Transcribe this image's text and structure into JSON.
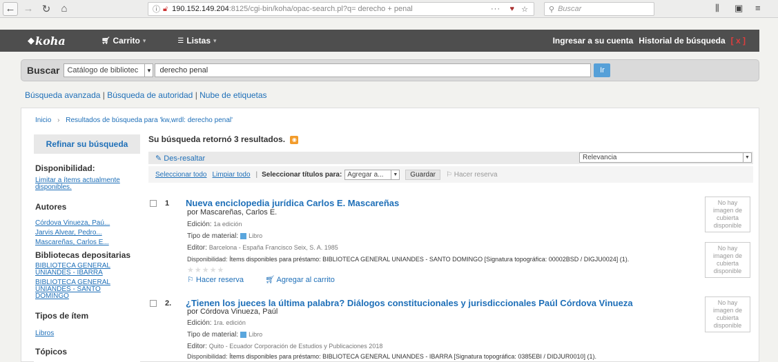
{
  "browser": {
    "url_host": "190.152.149.204",
    "url_path": ":8125/cgi-bin/koha/opac-search.pl?q= derecho + penal",
    "search_placeholder": "Buscar",
    "more": "···"
  },
  "navbar": {
    "logo": "koha",
    "cart": "Carrito",
    "lists": "Listas",
    "login": "Ingresar a su cuenta",
    "history": "Historial de búsqueda",
    "history_clear": "[ x ]"
  },
  "search": {
    "label": "Buscar",
    "scope": "Catálogo de bibliotec",
    "query": "derecho penal",
    "go": "Ir"
  },
  "links": {
    "advanced": "Búsqueda avanzada",
    "authority": "Búsqueda de autoridad",
    "tags": "Nube de etiquetas"
  },
  "breadcrumb": {
    "home": "Inicio",
    "current": "Resultados de búsqueda para 'kw,wrdl: derecho penal'"
  },
  "sidebar": {
    "refine": "Refinar su búsqueda",
    "availability_h": "Disponibilidad:",
    "availability_link": "Limitar a ítems actualmente disponibles.",
    "authors_h": "Autores",
    "authors": [
      "Córdova Vinueza, Paú...",
      "Jarvis Alvear, Pedro...",
      "Mascareñas, Carlos E..."
    ],
    "libraries_h": "Bibliotecas depositarias",
    "libraries": [
      "BIBLIOTECA GENERAL UNIANDES - IBARRA",
      "BIBLIOTECA GENERAL UNIANDES - SANTO DOMINGO"
    ],
    "itemtypes_h": "Tipos de ítem",
    "itemtypes": [
      "Libros"
    ],
    "topics_h": "Tópicos"
  },
  "results": {
    "count": "Su búsqueda retornó 3 resultados.",
    "unhighlight": "Des-resaltar",
    "sort": "Relevancia",
    "select_all": "Seleccionar todo",
    "clear_all": "Limpiar todo",
    "select_titles": "Seleccionar títulos para:",
    "add_to": "Agregar a...",
    "save": "Guardar",
    "place_hold": "Hacer reserva",
    "no_cover": "No hay imagen de cubierta disponible",
    "records": [
      {
        "num": "1",
        "title": "Nueva enciclopedia jurídica Carlos E. Mascareñas",
        "by": "por Mascareñas, Carlos E.",
        "edition_k": "Edición:",
        "edition_v": "1a edición",
        "material_k": "Tipo de material:",
        "material_v": "Libro",
        "publisher_k": "Editor:",
        "publisher_v": "Barcelona - España Francisco Seix, S. A. 1985",
        "avail_k": "Disponibilidad:",
        "avail_v": "Ítems disponibles para préstamo: BIBLIOTECA GENERAL UNIANDES - SANTO DOMINGO [Signatura topográfica: 00002BSD / DIGJU0024] (1).",
        "stars": "★★★★★",
        "hold": "Hacer reserva",
        "cart": "Agregar al carrito"
      },
      {
        "num": "2.",
        "title": "¿Tienen los jueces la última palabra? Diálogos constitucionales y jurisdiccionales Paúl Córdova Vinueza",
        "by": "por Córdova Vinueza, Paúl",
        "edition_k": "Edición:",
        "edition_v": "1ra. edición",
        "material_k": "Tipo de material:",
        "material_v": "Libro",
        "publisher_k": "Editor:",
        "publisher_v": "Quito - Ecuador Corporación de Estudios y Publicaciones 2018",
        "avail_k": "Disponibilidad:",
        "avail_v": "Ítems disponibles para préstamo: BIBLIOTECA GENERAL UNIANDES - IBARRA [Signatura topográfica: 0385EBI / DIDJUR0010] (1)."
      }
    ]
  }
}
